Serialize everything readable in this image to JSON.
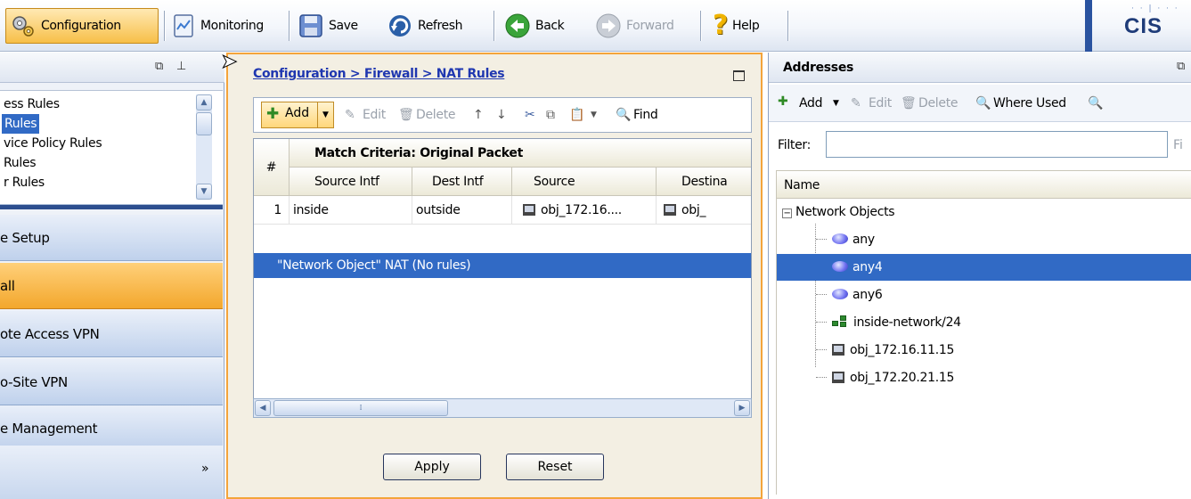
{
  "toolbar": {
    "configuration": "Configuration",
    "monitoring": "Monitoring",
    "save": "Save",
    "refresh": "Refresh",
    "back": "Back",
    "forward": "Forward",
    "help": "Help",
    "brand": "CIS"
  },
  "left_panel": {
    "tree_items": [
      {
        "label": "ess Rules",
        "selected": false
      },
      {
        "label": "Rules",
        "selected": true
      },
      {
        "label": "vice Policy Rules",
        "selected": false
      },
      {
        "label": "Rules",
        "selected": false
      },
      {
        "label": "r Rules",
        "selected": false
      }
    ],
    "nav_items": [
      {
        "label": "e Setup",
        "selected": false
      },
      {
        "label": "all",
        "selected": true
      },
      {
        "label": "ote Access VPN",
        "selected": false
      },
      {
        "label": "o-Site VPN",
        "selected": false
      },
      {
        "label": "e Management",
        "selected": false
      }
    ],
    "more_glyph": "»"
  },
  "center": {
    "breadcrumb": "Configuration > Firewall > NAT Rules",
    "toolbar": {
      "add": "Add",
      "edit": "Edit",
      "delete": "Delete",
      "find": "Find"
    },
    "grid": {
      "col_number": "#",
      "group_header": "Match Criteria: Original Packet",
      "columns": [
        "Source Intf",
        "Dest Intf",
        "Source",
        "Destina"
      ],
      "rows": [
        {
          "num": "1",
          "source_intf": "inside",
          "dest_intf": "outside",
          "source": "obj_172.16....",
          "destination": "obj_"
        }
      ],
      "group_row": "\"Network Object\" NAT (No rules)"
    },
    "apply": "Apply",
    "reset": "Reset"
  },
  "right_panel": {
    "title": "Addresses",
    "toolbar": {
      "add": "Add",
      "edit": "Edit",
      "delete": "Delete",
      "where_used": "Where Used"
    },
    "filter_label": "Filter:",
    "filter_value": "",
    "filter_tail": "Fi",
    "column_name": "Name",
    "tree_root": "Network Objects",
    "objects": [
      {
        "name": "any",
        "icon": "globe-icon",
        "selected": false
      },
      {
        "name": "any4",
        "icon": "globe-icon",
        "selected": true
      },
      {
        "name": "any6",
        "icon": "globe-icon",
        "selected": false
      },
      {
        "name": "inside-network/24",
        "icon": "network-icon",
        "selected": false
      },
      {
        "name": "obj_172.16.11.15",
        "icon": "host-icon",
        "selected": false
      },
      {
        "name": "obj_172.20.21.15",
        "icon": "host-icon",
        "selected": false
      }
    ]
  },
  "colors": {
    "selection": "#316ac5",
    "active_orange": "#f4a43a",
    "link_blue": "#1f37b0"
  }
}
